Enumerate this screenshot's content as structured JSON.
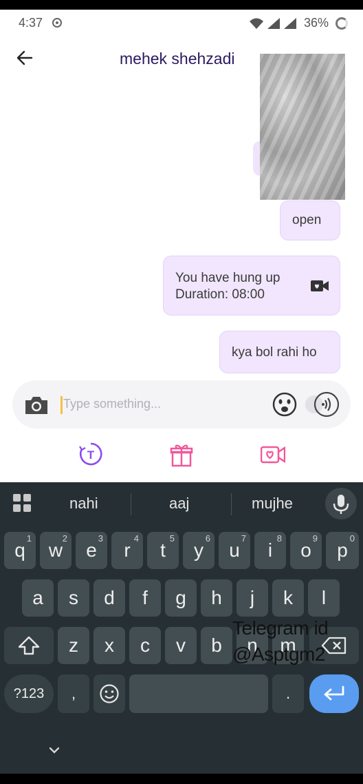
{
  "status_bar": {
    "time": "4:37",
    "battery": "36%"
  },
  "header": {
    "title": "mehek shehzadi"
  },
  "messages": [
    {
      "text": "open"
    },
    {
      "line1": "You have hung up",
      "line2": "Duration: 08:00"
    },
    {
      "text": "kya bol rahi ho"
    }
  ],
  "composer": {
    "placeholder": "Type something..."
  },
  "keyboard": {
    "suggestions": [
      "nahi",
      "aaj",
      "mujhe"
    ],
    "row1": [
      {
        "k": "q",
        "n": "1"
      },
      {
        "k": "w",
        "n": "2"
      },
      {
        "k": "e",
        "n": "3"
      },
      {
        "k": "r",
        "n": "4"
      },
      {
        "k": "t",
        "n": "5"
      },
      {
        "k": "y",
        "n": "6"
      },
      {
        "k": "u",
        "n": "7"
      },
      {
        "k": "i",
        "n": "8"
      },
      {
        "k": "o",
        "n": "9"
      },
      {
        "k": "p",
        "n": "0"
      }
    ],
    "row2": [
      "a",
      "s",
      "d",
      "f",
      "g",
      "h",
      "j",
      "k",
      "l"
    ],
    "row3": [
      "z",
      "x",
      "c",
      "v",
      "b",
      "n",
      "m"
    ],
    "sym_label": "?123",
    "comma": ",",
    "period": "."
  },
  "watermark": {
    "line1": "Telegram id",
    "line2": "@Asptgm2"
  },
  "colors": {
    "bubble": "#f1e6fd",
    "accent_purple": "#8a4bef",
    "accent_pink": "#f2579a",
    "keyboard_bg": "#263034",
    "enter_key": "#5a9cf0"
  }
}
